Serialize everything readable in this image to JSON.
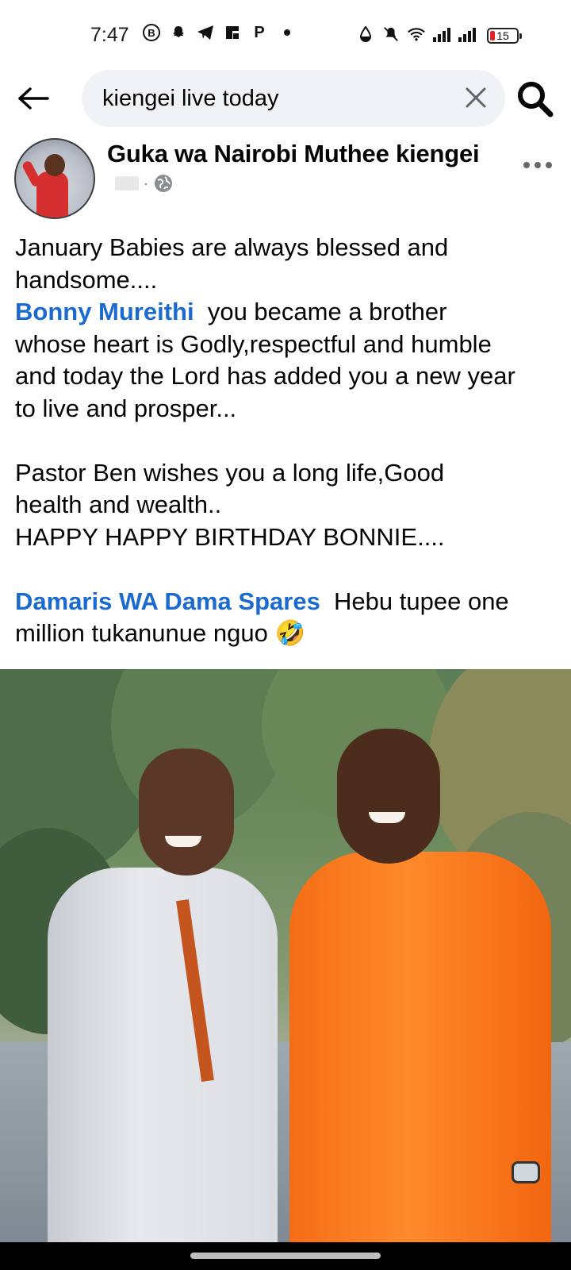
{
  "status_bar": {
    "time": "7:47",
    "battery": "15",
    "icons": [
      "b-icon",
      "snapchat-icon",
      "telegram-icon",
      "flipboard-icon",
      "p-icon",
      "dot-icon",
      "drop-icon",
      "mute-icon",
      "wifi-icon",
      "signal-icon",
      "signal-icon"
    ]
  },
  "search": {
    "query": "kiengei live today"
  },
  "post": {
    "author": "Guka wa Nairobi Muthee kiengei",
    "lines": {
      "l1": "January Babies are always blessed and",
      "l2": "handsome....",
      "mention1": "Bonny Mureithi",
      "l3_rest": "  you became a brother",
      "l4": "whose heart is Godly,respectful and humble",
      "l5": "and today the Lord has added you a new year",
      "l6": "to live and prosper...",
      "l7": "Pastor Ben wishes you a long life,Good",
      "l8": "health and wealth..",
      "l9": "HAPPY HAPPY BIRTHDAY BONNIE....",
      "mention2": "Damaris WA Dama Spares",
      "l10_rest": "  Hebu tupee one",
      "l11": "million tukanunue nguo",
      "emoji": "🤣"
    }
  },
  "colors": {
    "mention": "#1b6ad0",
    "search_bg": "#f0f2f5",
    "meta_gray": "#65676b"
  }
}
